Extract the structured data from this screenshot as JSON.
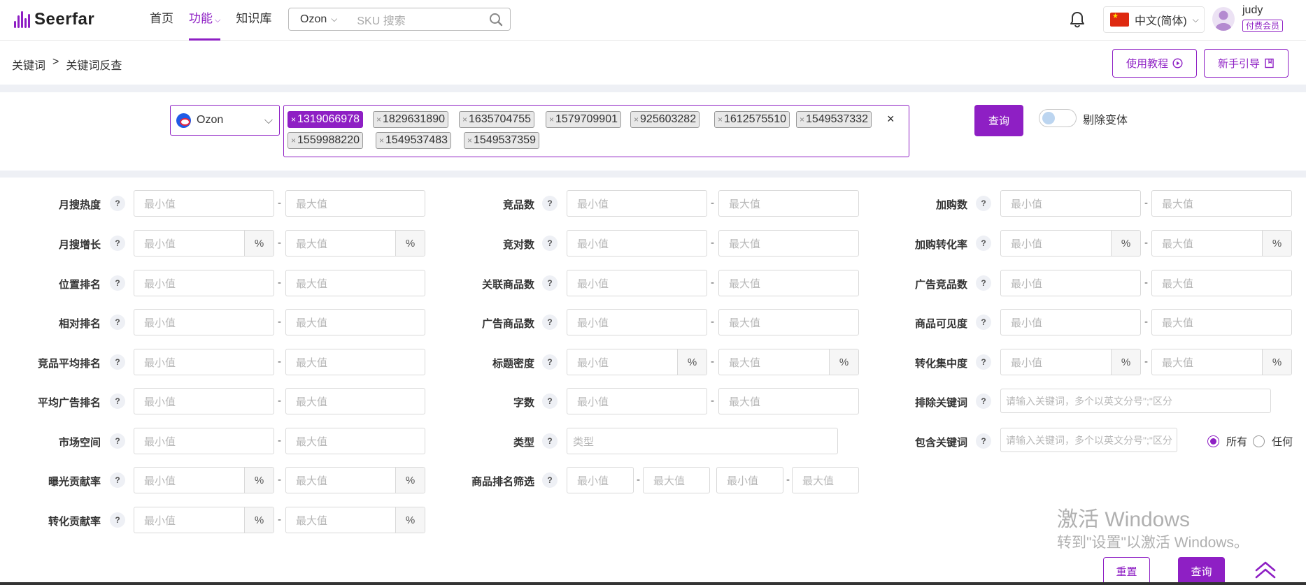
{
  "header": {
    "logo_text": "Seerfar",
    "nav": [
      {
        "label": "首页"
      },
      {
        "label": "功能"
      },
      {
        "label": "知识库"
      }
    ],
    "search": {
      "platform": "Ozon",
      "placeholder": "SKU 搜索"
    },
    "language": "中文(简体)",
    "user": {
      "name": "judy",
      "badge": "付费会员"
    }
  },
  "breadcrumb": {
    "items": [
      "关键词",
      ">",
      "关键词反查"
    ]
  },
  "actions": {
    "tutorial": "使用教程",
    "guide": "新手引导"
  },
  "query": {
    "platform": "Ozon",
    "skus": [
      "1319066978",
      "1829631890",
      "1635704755",
      "1579709901",
      "925603282",
      "1612575510",
      "1549537332",
      "1559988220",
      "1549537483",
      "1549537359"
    ],
    "clear_symbol": "×",
    "submit_label": "查询",
    "toggle_label": "剔除变体"
  },
  "filters": {
    "min": "最小值",
    "max": "最大值",
    "pct": "%",
    "dash": "-",
    "help": "?",
    "col1": [
      "月搜热度",
      "月搜增长",
      "位置排名",
      "相对排名",
      "竞品平均排名",
      "平均广告排名",
      "市场空间",
      "曝光贡献率",
      "转化贡献率"
    ],
    "col2": [
      "竞品数",
      "竞对数",
      "关联商品数",
      "广告商品数",
      "标题密度",
      "字数",
      "类型",
      "商品排名筛选"
    ],
    "col3": [
      "加购数",
      "加购转化率",
      "广告竞品数",
      "商品可见度",
      "转化集中度",
      "排除关键词",
      "包含关键词"
    ],
    "type_placeholder": "类型",
    "keyword_placeholder": "请输入关键词，多个以英文分号\";\"区分",
    "include_modes": [
      "所有",
      "任何"
    ]
  },
  "watermark": {
    "line1": "激活 Windows",
    "line2": "转到\"设置\"以激活 Windows。"
  },
  "footer": {
    "reset_label": "重置",
    "query_label": "查询"
  },
  "colors": {
    "accent": "#8e1fc4",
    "stripe": "#eef0f5"
  }
}
